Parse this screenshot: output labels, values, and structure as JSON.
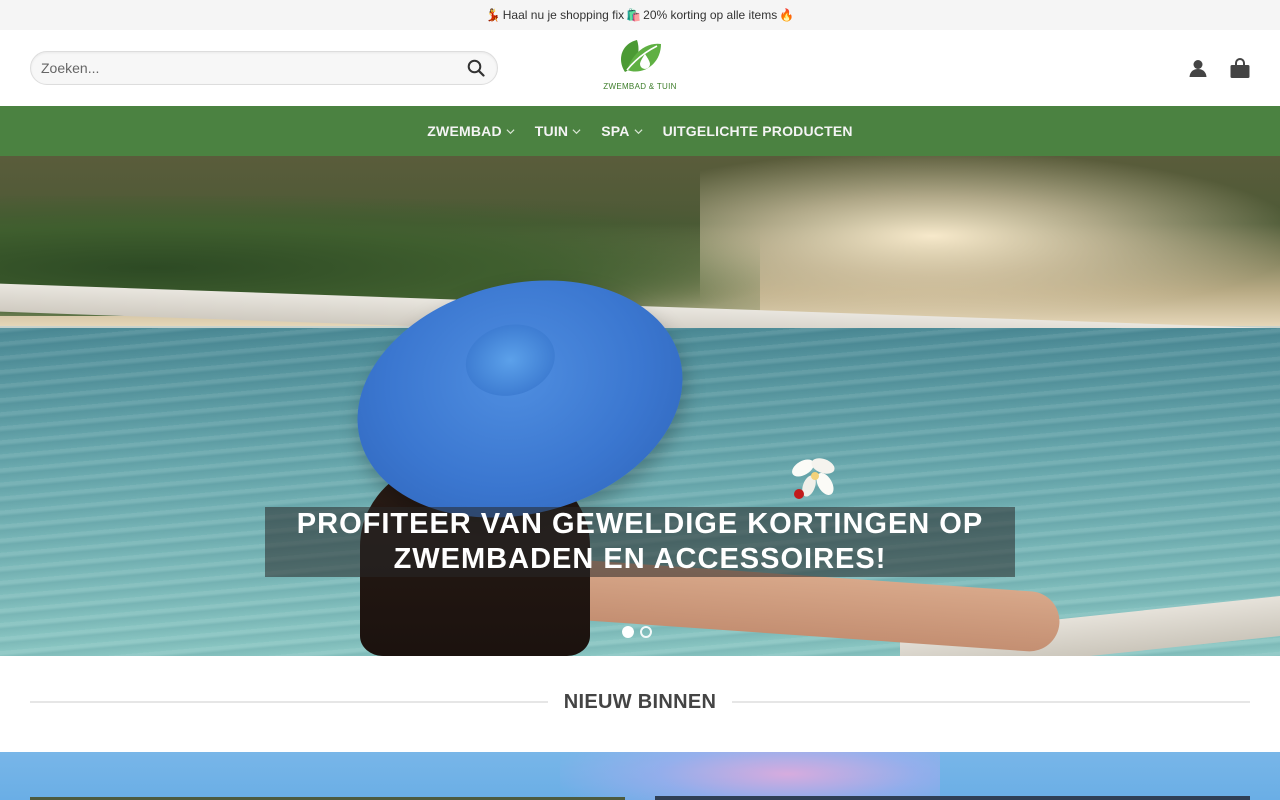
{
  "announcement": {
    "text": "Haal nu je shopping fix",
    "emoji_left": "💃",
    "emoji_mid": "🛍️",
    "discount_text": " 20% korting op alle items ",
    "emoji_right": "🔥"
  },
  "header": {
    "search_placeholder": "Zoeken...",
    "logo_text": "ZWEMBAD & TUIN"
  },
  "nav": {
    "items": [
      {
        "label": "ZWEMBAD",
        "has_dropdown": true
      },
      {
        "label": "TUIN",
        "has_dropdown": true
      },
      {
        "label": "SPA",
        "has_dropdown": true
      },
      {
        "label": "UITGELICHTE PRODUCTEN",
        "has_dropdown": false
      }
    ]
  },
  "hero": {
    "caption_line1": "PROFITEER VAN GEWELDIGE KORTINGEN OP",
    "caption_line2": "ZWEMBADEN EN ACCESSOIRES!"
  },
  "section": {
    "title": "NIEUW BINNEN"
  },
  "colors": {
    "nav_bg": "#4b8241",
    "logo_green": "#3d7d2a"
  },
  "icons": {
    "search": "search-icon",
    "account": "user-icon",
    "cart": "shopping-bag-icon",
    "dropdown": "chevron-down-icon"
  }
}
